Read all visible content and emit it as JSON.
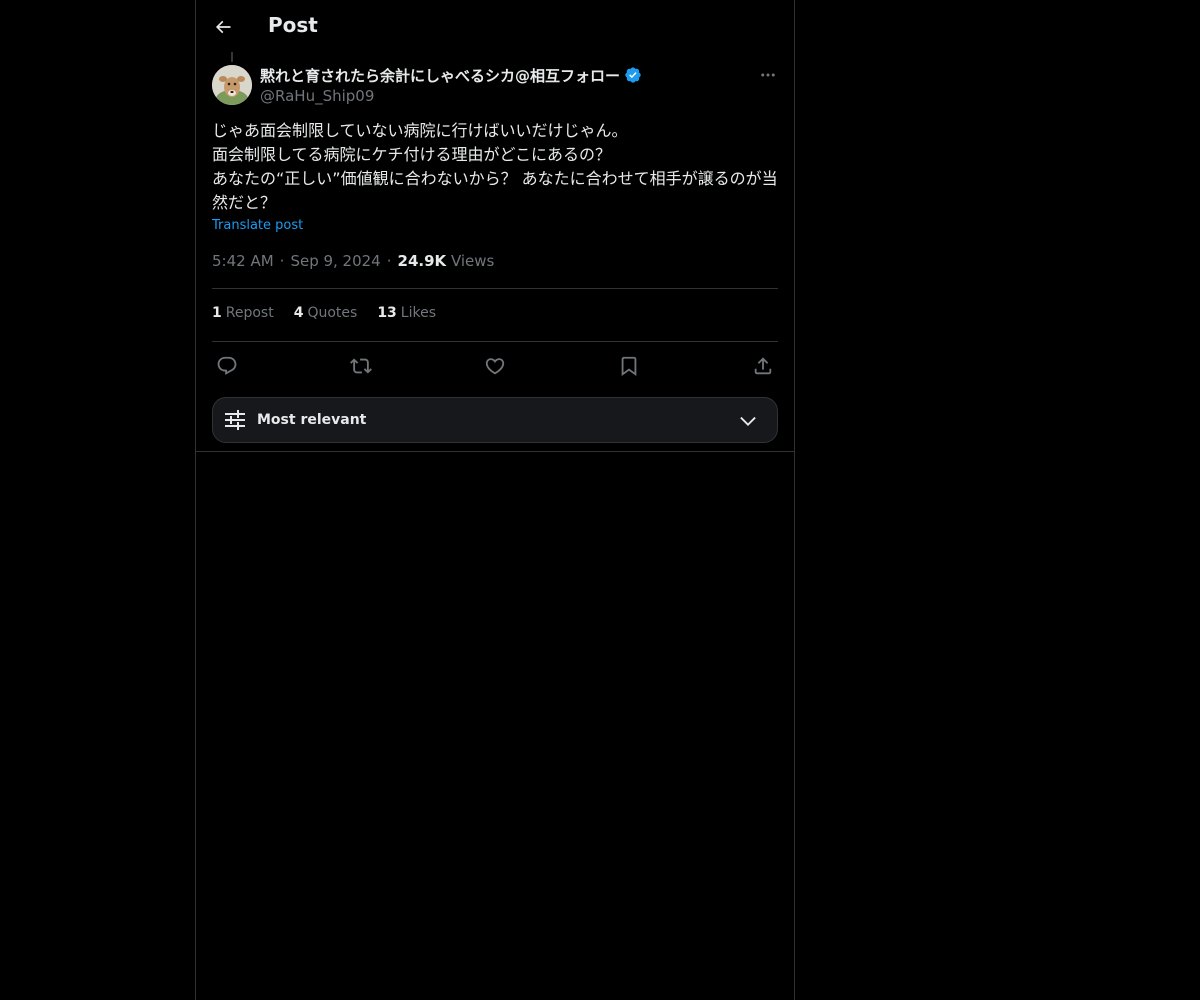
{
  "header": {
    "title": "Post",
    "back_icon": "arrow-left-icon"
  },
  "post": {
    "author": {
      "display_name": "黙れと育されたら余計にしゃべるシカ@相互フォロー",
      "handle": "@RaHu_Ship09",
      "verified": true,
      "avatar": "deer-avatar"
    },
    "text": "じゃあ面会制限していない病院に行けばいいだけじゃん。\n面会制限してる病院にケチ付ける理由がどこにあるの？\nあなたの“正しい”価値観に合わないから？ あなたに合わせて相手が譲るのが当然だと？",
    "translate_label": "Translate post",
    "time": "5:42 AM",
    "date": "Sep 9, 2024",
    "views_count": "24.9K",
    "views_label": "Views",
    "separator": "·"
  },
  "stats": {
    "reposts": {
      "count": "1",
      "label": "Repost"
    },
    "quotes": {
      "count": "4",
      "label": "Quotes"
    },
    "likes": {
      "count": "13",
      "label": "Likes"
    }
  },
  "actions": [
    "reply-icon",
    "repost-icon",
    "like-icon",
    "bookmark-icon",
    "share-icon"
  ],
  "sort": {
    "label": "Most relevant",
    "icon": "sliders-icon",
    "chevron": "chevron-down-icon"
  },
  "colors": {
    "background": "#000000",
    "text": "#e7e9ea",
    "muted": "#71767b",
    "accent": "#1d9bf0",
    "border": "#2f3336"
  }
}
